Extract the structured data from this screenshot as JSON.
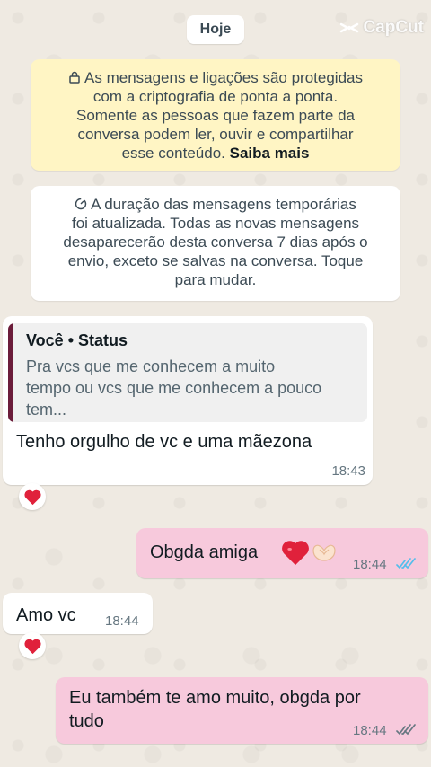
{
  "watermark": "CapCut",
  "date_chip": "Hoje",
  "encryption_notice": {
    "lines": [
      "As mensagens e ligações são protegidas",
      "com a criptografia de ponta a ponta.",
      "Somente as pessoas que fazem parte da",
      "conversa podem ler, ouvir e compartilhar",
      "esse conteúdo."
    ],
    "link": "Saiba mais"
  },
  "timer_notice": {
    "lines": [
      "A duração das mensagens temporárias",
      "foi atualizada. Todas as novas mensagens",
      "desaparecerão desta conversa 7 dias após o",
      "envio, exceto se salvas na conversa. Toque",
      "para mudar."
    ]
  },
  "messages": [
    {
      "direction": "in",
      "quote_author": "Você • Status",
      "quote_lines": [
        "Pra vcs que me conhecem a muito",
        "tempo ou vcs que me conhecem a pouco",
        "tem..."
      ],
      "text": "Tenho orgulho de vc e uma mãezona",
      "time": "18:43",
      "reaction": "red-heart"
    },
    {
      "direction": "out",
      "text": "Obgda amiga",
      "emojis": [
        "red-heart",
        "heart-hands"
      ],
      "time": "18:44",
      "status": "read"
    },
    {
      "direction": "in",
      "text": "Amo vc",
      "time": "18:44",
      "reaction": "red-heart"
    },
    {
      "direction": "out",
      "text_lines": [
        "Eu também te amo muito, obgda por",
        "tudo"
      ],
      "time": "18:44",
      "status": "delivered"
    }
  ],
  "colors": {
    "background": "#efeae2",
    "encryption_bg": "#fff5c4",
    "outgoing_bubble": "#f7c9dc",
    "quote_bar": "#6b1c3a",
    "read_ticks": "#53bdeb",
    "delivered_ticks": "#667781"
  }
}
